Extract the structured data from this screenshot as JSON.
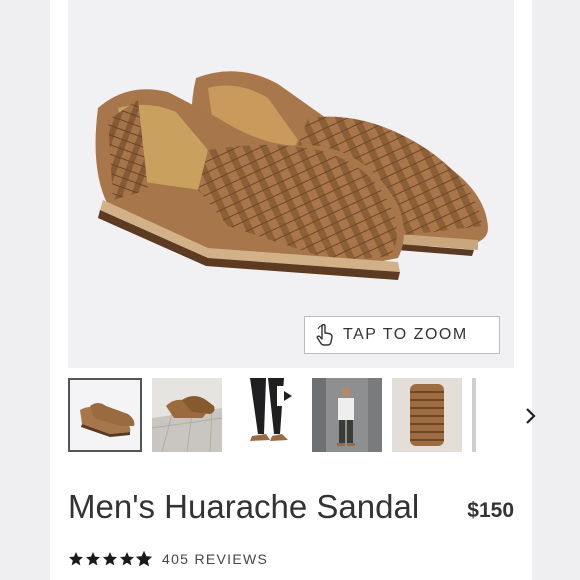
{
  "product": {
    "title": "Men's Huarache Sandal",
    "price": "$150",
    "rating": 4.5,
    "rating_max": 5,
    "reviews_label": "405 REVIEWS"
  },
  "gallery": {
    "zoom_label": "TAP TO ZOOM",
    "zoom_icon": "hand-pointer-icon",
    "next_icon": "chevron-right-icon",
    "thumbnails": [
      {
        "name": "thumb-shoes-pair",
        "active": true
      },
      {
        "name": "thumb-shoes-on-tiles",
        "active": false
      },
      {
        "name": "thumb-video-model-legs",
        "active": false,
        "video": true
      },
      {
        "name": "thumb-model-street",
        "active": false
      },
      {
        "name": "thumb-shoes-stack",
        "active": false
      },
      {
        "name": "thumb-partial",
        "active": false
      }
    ]
  },
  "colors": {
    "leather": "#a9794c",
    "leather_dark": "#7d5430",
    "text": "#333333",
    "background": "#f1f0f3"
  }
}
